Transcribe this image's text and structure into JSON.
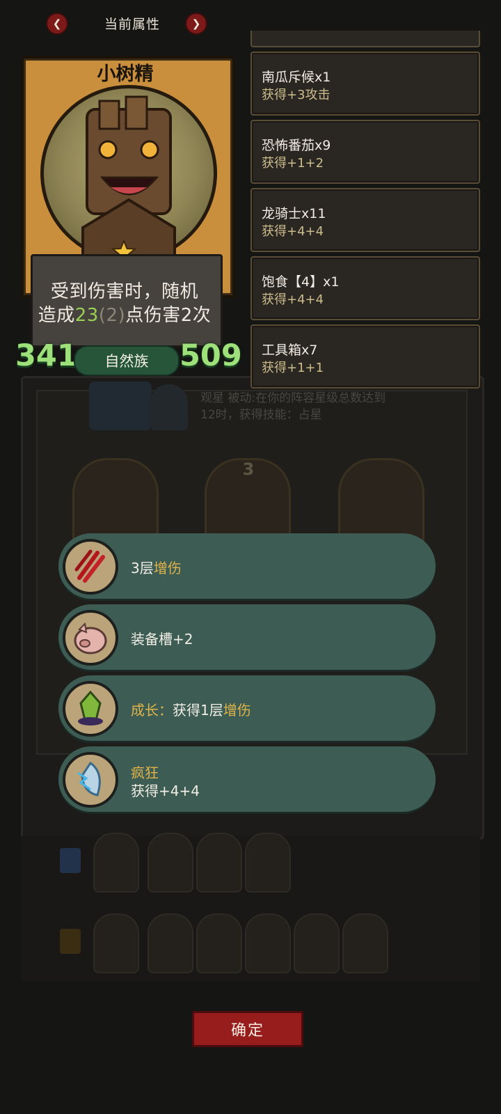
{
  "header": {
    "title": "当前属性"
  },
  "unit": {
    "name": "小树精",
    "desc_line1": "受到伤害时，随机",
    "desc_pre": "造成",
    "desc_num": "23",
    "desc_paren": "(2)",
    "desc_post": "点伤害2次",
    "attack": "341",
    "health": "509",
    "tribe": "自然族",
    "star_count": 1
  },
  "equipment": [
    {
      "name": "南瓜斥候x1",
      "bonus": "获得+3攻击"
    },
    {
      "name": "恐怖番茄x9",
      "bonus": "获得+1+2"
    },
    {
      "name": "龙骑士x11",
      "bonus": "获得+4+4"
    },
    {
      "name": "饱食【4】x1",
      "bonus": "获得+4+4"
    },
    {
      "name": "工具箱x7",
      "bonus": "获得+1+1"
    }
  ],
  "background": {
    "passive_line1": "观星 被动:在你的阵容星级总数达到",
    "passive_line2": "12时，获得技能：占星",
    "card_rank": "3"
  },
  "options": [
    {
      "icon": "claw-slash-icon",
      "prefix": "3层",
      "highlight": "增伤"
    },
    {
      "icon": "pig-icon",
      "text": "装备槽+2"
    },
    {
      "icon": "green-crystal-icon",
      "prefix_gold": "成长：",
      "mid": "获得1层",
      "highlight": "增伤"
    },
    {
      "icon": "lightning-crest-icon",
      "title": "疯狂",
      "sub": "获得+4+4"
    }
  ],
  "confirm_label": "确定",
  "colors": {
    "accent_red": "#971c1c",
    "option_bg": "#3d5c53",
    "gold": "#e0b44a",
    "stat_green": "#9ee07a"
  }
}
